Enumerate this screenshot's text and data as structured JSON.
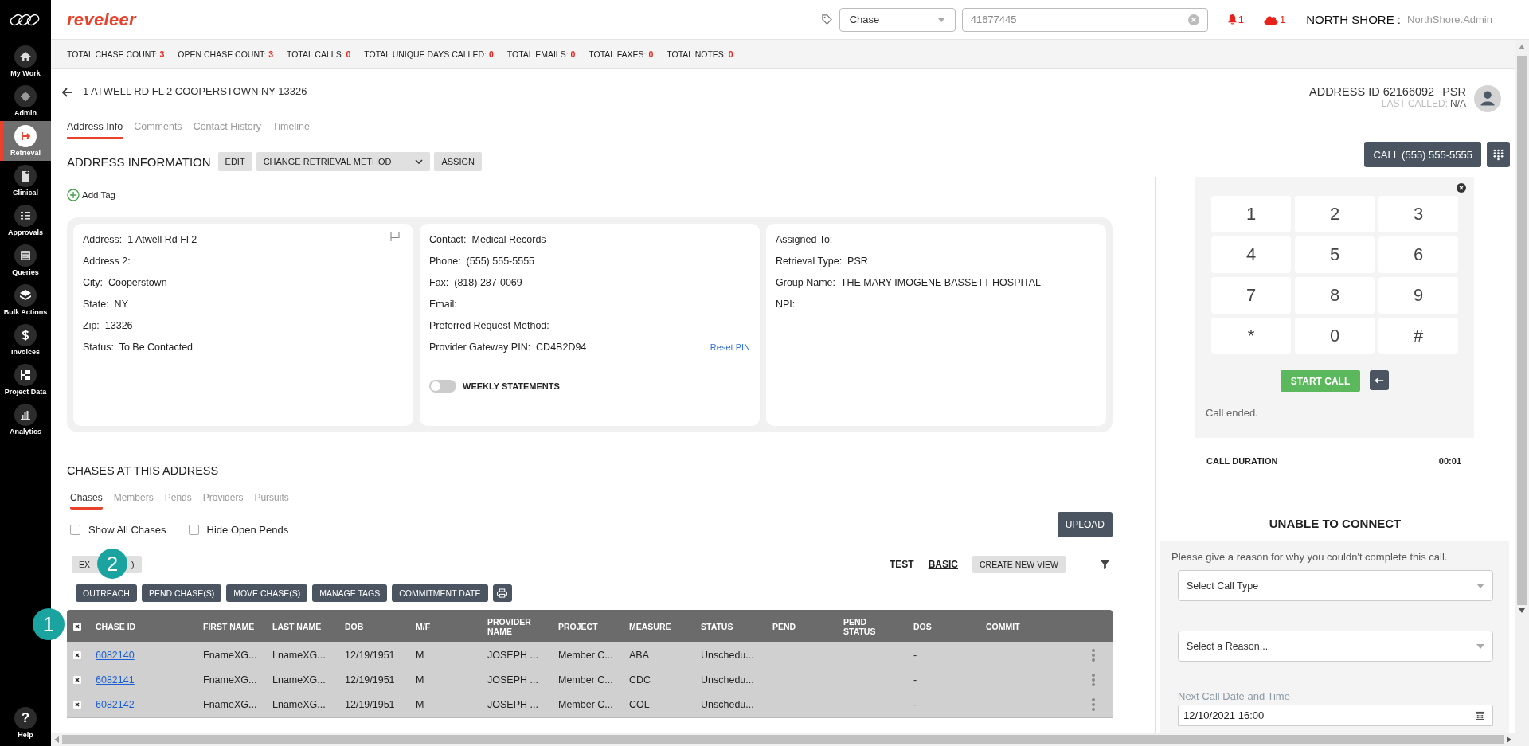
{
  "sidebar": {
    "items": [
      {
        "label": "My Work",
        "selected": false
      },
      {
        "label": "Admin",
        "selected": false
      },
      {
        "label": "Retrieval",
        "selected": true
      },
      {
        "label": "Clinical",
        "selected": false
      },
      {
        "label": "Approvals",
        "selected": false
      },
      {
        "label": "Queries",
        "selected": false
      },
      {
        "label": "Bulk Actions",
        "selected": false
      },
      {
        "label": "Invoices",
        "selected": false
      },
      {
        "label": "Project Data",
        "selected": false
      },
      {
        "label": "Analytics",
        "selected": false
      }
    ],
    "help": {
      "glyph": "?",
      "label": "Help"
    }
  },
  "header": {
    "logo": "reveleer",
    "search_type": "Chase",
    "search_value": "41677445",
    "alerts": [
      {
        "kind": "bell",
        "count": "1"
      },
      {
        "kind": "cloud",
        "count": "1"
      }
    ],
    "org": "NORTH SHORE :",
    "user": "NorthShore.Admin"
  },
  "counts": [
    {
      "label": "TOTAL CHASE COUNT:",
      "value": "3"
    },
    {
      "label": "OPEN CHASE COUNT:",
      "value": "3"
    },
    {
      "label": "TOTAL CALLS:",
      "value": "0"
    },
    {
      "label": "TOTAL UNIQUE DAYS CALLED:",
      "value": "0"
    },
    {
      "label": "TOTAL EMAILS:",
      "value": "0"
    },
    {
      "label": "TOTAL FAXES:",
      "value": "0"
    },
    {
      "label": "TOTAL NOTES:",
      "value": "0"
    }
  ],
  "page": {
    "title": "1 ATWELL RD FL 2 COOPERSTOWN NY 13326",
    "address_id": "ADDRESS ID 62166092",
    "type": "PSR",
    "last_called_label": "LAST CALLED:",
    "last_called": "N/A"
  },
  "tabs": [
    {
      "label": "Address Info",
      "selected": true
    },
    {
      "label": "Comments",
      "selected": false
    },
    {
      "label": "Contact History",
      "selected": false
    },
    {
      "label": "Timeline",
      "selected": false
    }
  ],
  "address_information": {
    "title": "ADDRESS INFORMATION",
    "buttons": [
      {
        "kind": "button",
        "label": "EDIT"
      },
      {
        "kind": "dropdown",
        "label": "CHANGE RETRIEVAL METHOD"
      },
      {
        "kind": "button",
        "label": "ASSIGN"
      }
    ],
    "add_tag": "Add Tag",
    "cards": [
      {
        "kind": "address",
        "fields": [
          {
            "label": "Address:",
            "value": "1 Atwell Rd Fl 2"
          },
          {
            "label": "Address 2:"
          },
          {
            "label": "City:",
            "value": "Cooperstown"
          },
          {
            "label": "State:",
            "value": "NY"
          },
          {
            "label": "Zip:",
            "value": "13326"
          },
          {
            "label": "Status:",
            "value": "To Be Contacted"
          }
        ]
      },
      {
        "kind": "contact",
        "fields": [
          {
            "label": "Contact:",
            "value": "Medical Records"
          },
          {
            "label": "Phone:",
            "value": "(555) 555-5555"
          },
          {
            "label": "Fax:",
            "value": "(818) 287-0069"
          },
          {
            "label": "Email:"
          },
          {
            "label": "Preferred Request Method:"
          },
          {
            "label": "Provider Gateway PIN:",
            "value": "CD4B2D94",
            "link": "Reset PIN"
          }
        ],
        "toggle": {
          "label": "WEEKLY STATEMENTS",
          "on": false
        }
      },
      {
        "kind": "assignment",
        "fields": [
          {
            "label": "Assigned To:"
          },
          {
            "label": "Retrieval Type:",
            "value": "PSR"
          },
          {
            "label": "Group Name:",
            "value": "THE MARY IMOGENE BASSETT HOSPITAL"
          },
          {
            "label": "NPI:"
          }
        ]
      }
    ]
  },
  "chases": {
    "title": "CHASES AT THIS ADDRESS",
    "tabs": [
      {
        "label": "Chases",
        "selected": true
      },
      {
        "label": "Members",
        "selected": false
      },
      {
        "label": "Pends",
        "selected": false
      },
      {
        "label": "Providers",
        "selected": false
      },
      {
        "label": "Pursuits",
        "selected": false
      }
    ],
    "filters": [
      {
        "label": "Show All Chases",
        "checked": false
      },
      {
        "label": "Hide Open Pends",
        "checked": false
      }
    ],
    "upload": "UPLOAD",
    "export_parts": [
      "EX",
      ")"
    ],
    "views": [
      {
        "label": "TEST",
        "selected": false
      },
      {
        "label": "BASIC",
        "selected": true
      }
    ],
    "create_view": "CREATE NEW VIEW",
    "actions": [
      "OUTREACH",
      "PEND CHASE(S)",
      "MOVE CHASE(S)",
      "MANAGE TAGS",
      "COMMITMENT DATE"
    ],
    "table": {
      "all_checked": true,
      "columns": [
        "CHASE ID",
        "FIRST NAME",
        "LAST NAME",
        "DOB",
        "M/F",
        "PROVIDER NAME",
        "PROJECT",
        "MEASURE",
        "STATUS",
        "PEND",
        "PEND STATUS",
        "DOS",
        "COMMIT"
      ],
      "rows": [
        {
          "checked": true,
          "chase_id": "6082140",
          "first_name": "FnameXG...",
          "last_name": "LnameXG...",
          "dob": "12/19/1951",
          "sex": "M",
          "provider": "JOSEPH ...",
          "project": "Member C...",
          "measure": "ABA",
          "status": "Unschedu...",
          "dos": "-"
        },
        {
          "checked": true,
          "chase_id": "6082141",
          "first_name": "FnameXG...",
          "last_name": "LnameXG...",
          "dob": "12/19/1951",
          "sex": "M",
          "provider": "JOSEPH ...",
          "project": "Member C...",
          "measure": "CDC",
          "status": "Unschedu...",
          "dos": "-"
        },
        {
          "checked": true,
          "chase_id": "6082142",
          "first_name": "FnameXG...",
          "last_name": "LnameXG...",
          "dob": "12/19/1951",
          "sex": "M",
          "provider": "JOSEPH ...",
          "project": "Member C...",
          "measure": "COL",
          "status": "Unschedu...",
          "dos": "-"
        }
      ]
    }
  },
  "call": {
    "button": "CALL (555) 555-5555",
    "keys": [
      "1",
      "2",
      "3",
      "4",
      "5",
      "6",
      "7",
      "8",
      "9",
      "*",
      "0",
      "#"
    ],
    "start": "START CALL",
    "status": "Call ended.",
    "duration_label": "CALL DURATION",
    "duration": "00:01"
  },
  "unable": {
    "title": "UNABLE TO CONNECT",
    "prompt": "Please give a reason for why you couldn't complete this call.",
    "selects": [
      {
        "placeholder": "Select Call Type"
      },
      {
        "placeholder": "Select a Reason..."
      }
    ],
    "next_label": "Next Call Date and Time",
    "next_value": "12/10/2021 16:00"
  },
  "callouts": [
    {
      "number": "1"
    },
    {
      "number": "2"
    }
  ]
}
